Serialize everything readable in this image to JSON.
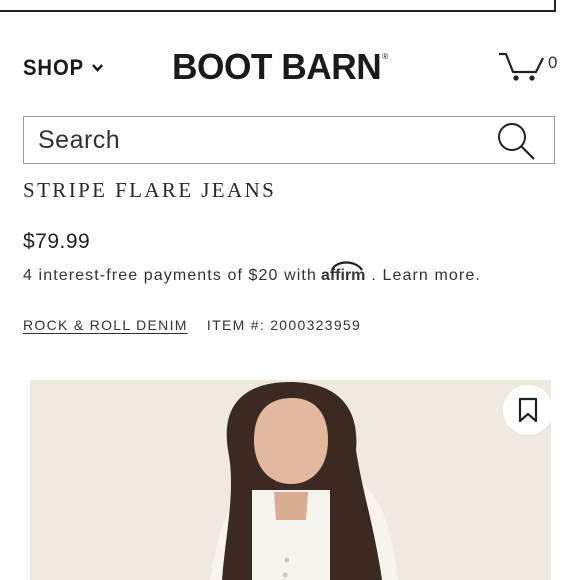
{
  "header": {
    "shop_label": "SHOP",
    "logo_text": "BOOT BARN",
    "logo_mark": "®",
    "cart_count": "0"
  },
  "search": {
    "placeholder": "Search"
  },
  "product": {
    "title": "STRIPE FLARE JEANS",
    "price": "$79.99",
    "installments_text": "4 interest-free payments of $20 with",
    "affirm_label": "affirm",
    "learn_more": ". Learn more.",
    "brand": "ROCK & ROLL DENIM",
    "item_number": "ITEM #: 2000323959"
  },
  "icons": {
    "shop": "chevron-down-icon",
    "cart": "cart-icon",
    "search": "search-icon",
    "save": "bookmark-icon"
  },
  "colors": {
    "text": "#222222",
    "photo_background": "#efe9e2",
    "border": "#9a9a9a"
  }
}
